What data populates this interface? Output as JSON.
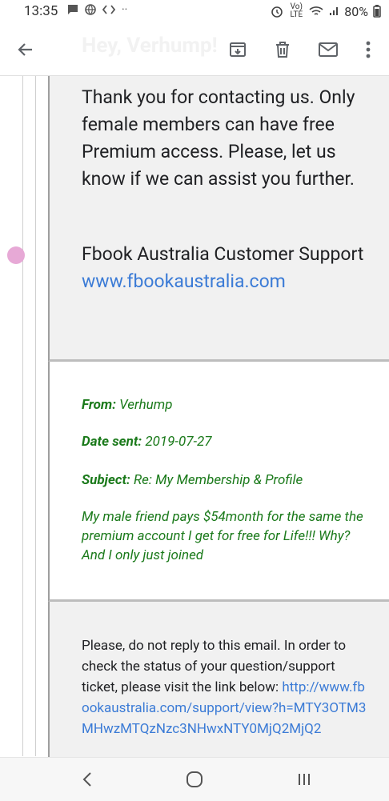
{
  "status": {
    "time": "13:35",
    "network": "Vo) LTE",
    "battery": "80%"
  },
  "header": {
    "title": "Hey, Verhump!"
  },
  "reply": {
    "body": "Thank you for contacting us. Only female members can have free Premium access. Please, let us know if we can assist you further.",
    "signature": "Fbook Australia Customer Support",
    "link": "www.fbookaustralia.com"
  },
  "quoted": {
    "from_label": "From:",
    "from_value": "Verhump",
    "date_label": "Date sent:",
    "date_value": "2019-07-27",
    "subject_label": "Subject:",
    "subject_value": "Re: My Membership & Profile",
    "message": "My male friend pays $54month for the same the premium account I get for free for Life!!! Why? And I only just joined"
  },
  "notice": {
    "text": "Please, do not reply to this email. In order to check the status of your question/support ticket, please visit the link below: ",
    "link": "http://www.fbookaustralia.com/support/view?h=MTY3OTM3MHwzMTQzNzc3NHwxNTY0MjQ2MjQ2"
  },
  "icons": {
    "back": "arrow-left-icon",
    "archive": "archive-icon",
    "delete": "trash-icon",
    "mail": "mail-icon",
    "more": "more-vert-icon"
  },
  "colors": {
    "green": "#1b7a1b",
    "link": "#3b7bd6",
    "grey_block": "#f1f1f1"
  }
}
